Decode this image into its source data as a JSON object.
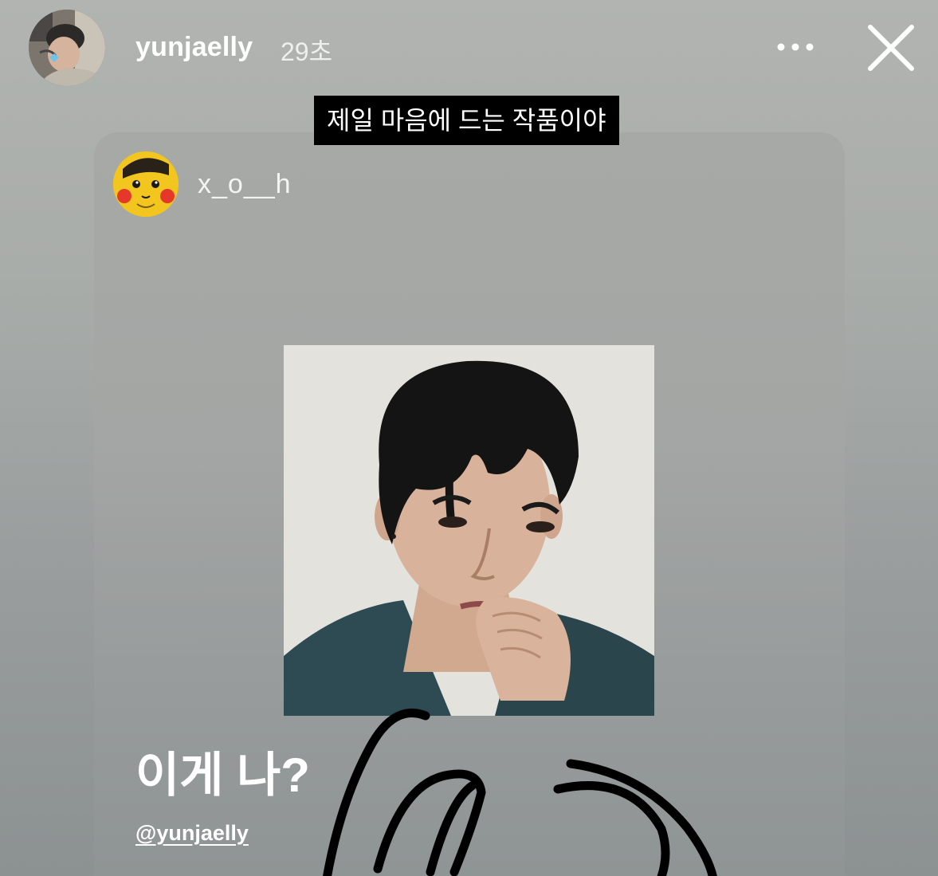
{
  "story": {
    "username": "yunjaelly",
    "timestamp": "29초",
    "more_icon": "more-horizontal-icon",
    "close_icon": "close-icon",
    "caption": "제일 마음에 드는 작품이야"
  },
  "shared_post": {
    "username": "x_o__h",
    "text": "이게 나?",
    "mention": "@yunjaelly"
  },
  "colors": {
    "background": "#a9adaa",
    "card": "#a3a6a4",
    "caption_bg": "#000000",
    "text": "#ffffff"
  }
}
